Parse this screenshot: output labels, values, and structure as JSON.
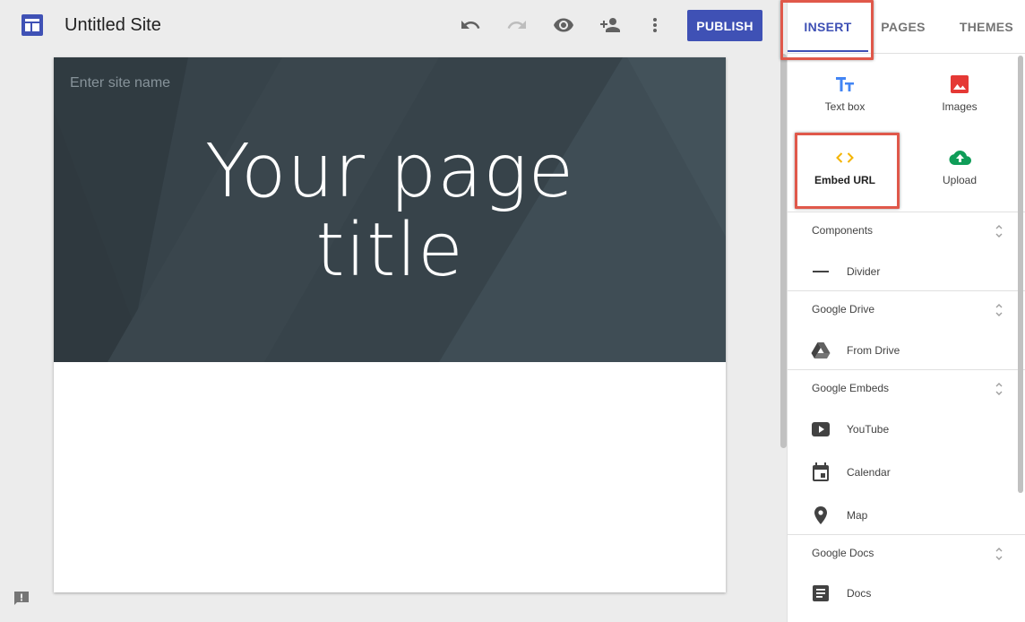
{
  "header": {
    "site_title": "Untitled Site",
    "publish_label": "PUBLISH",
    "icons": [
      "site-logo-icon",
      "undo-icon",
      "redo-icon",
      "preview-eye-icon",
      "share-person-add-icon",
      "more-vert-icon"
    ]
  },
  "canvas": {
    "site_name_placeholder": "Enter site name",
    "page_title_line1": "Your page",
    "page_title_line2": "title"
  },
  "panel": {
    "tabs": [
      {
        "label": "INSERT",
        "active": true
      },
      {
        "label": "PAGES",
        "active": false
      },
      {
        "label": "THEMES",
        "active": false
      }
    ],
    "tiles": [
      {
        "label": "Text box",
        "icon": "text-box-icon"
      },
      {
        "label": "Images",
        "icon": "image-icon"
      },
      {
        "label": "Embed URL",
        "icon": "embed-code-icon"
      },
      {
        "label": "Upload",
        "icon": "cloud-upload-icon"
      }
    ],
    "sections": [
      {
        "title": "Components",
        "items": [
          {
            "label": "Divider",
            "icon": "divider-icon"
          }
        ]
      },
      {
        "title": "Google Drive",
        "items": [
          {
            "label": "From Drive",
            "icon": "drive-icon"
          }
        ]
      },
      {
        "title": "Google Embeds",
        "items": [
          {
            "label": "YouTube",
            "icon": "youtube-icon"
          },
          {
            "label": "Calendar",
            "icon": "calendar-icon"
          },
          {
            "label": "Map",
            "icon": "map-pin-icon"
          }
        ]
      },
      {
        "title": "Google Docs",
        "items": [
          {
            "label": "Docs",
            "icon": "docs-icon"
          }
        ]
      }
    ]
  },
  "colors": {
    "accent": "#3f51b5",
    "highlight": "#e0584a",
    "hero_bg": "#37434a",
    "images_icon": "#e53935",
    "embed_icon": "#f4b400",
    "upload_icon": "#0f9d58",
    "textbox_icon": "#4285f4"
  }
}
